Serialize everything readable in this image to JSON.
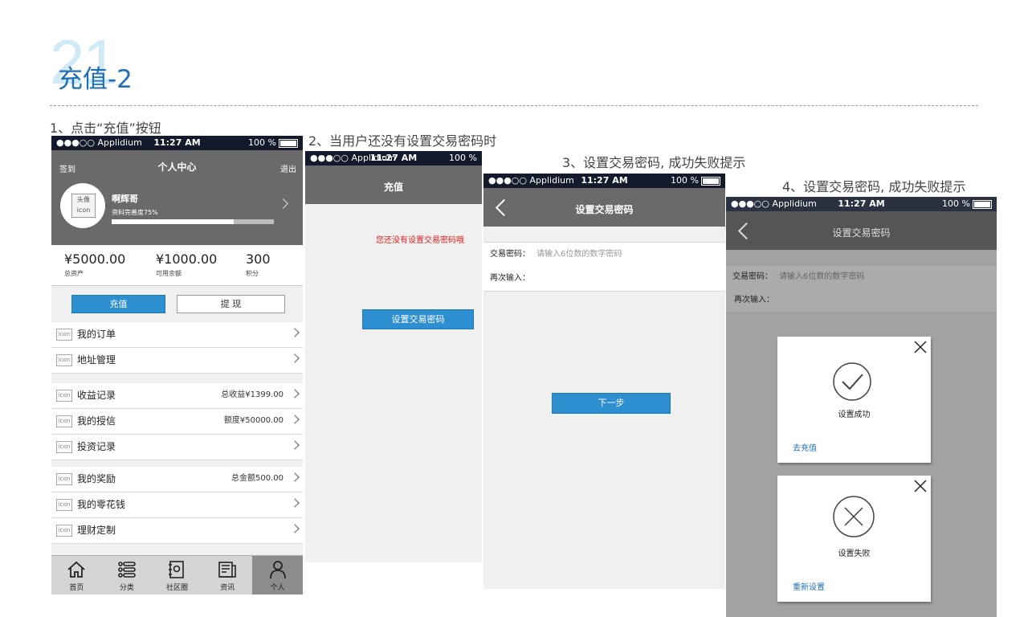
{
  "page": {
    "number": "21",
    "title": "充值-2"
  },
  "steps": [
    "1、点击“充值”按钮",
    "2、当用户还没有设置交易密码时",
    "3、设置交易密码, 成功失败提示",
    "4、设置交易密码, 成功失败提示"
  ],
  "statusbar": {
    "carrier": "●●●○○ Applidium ",
    "time": "11:27 AM",
    "battery": "100 %"
  },
  "screen1": {
    "header": {
      "left": "签到",
      "title": "个人中心",
      "right": "退出"
    },
    "profile": {
      "avatar": "头像 icon",
      "name": "啊辉哥",
      "completion": "资料完善度75%",
      "progress": 0.75
    },
    "stats": [
      {
        "value": "¥5000.00",
        "label": "总资产"
      },
      {
        "value": "¥1000.00",
        "label": "可用余额"
      },
      {
        "value": "300",
        "label": "积分"
      }
    ],
    "recharge_button": "充值",
    "withdraw_button": "提 现",
    "icon_text": "icon",
    "group1": [
      {
        "label": "我的订单",
        "value": ""
      },
      {
        "label": "地址管理",
        "value": ""
      }
    ],
    "group2": [
      {
        "label": "收益记录",
        "value": "总收益¥1399.00"
      },
      {
        "label": "我的授信",
        "value": "额度¥50000.00"
      },
      {
        "label": "投资记录",
        "value": ""
      }
    ],
    "group3": [
      {
        "label": "我的奖励",
        "value": "总金额500.00"
      },
      {
        "label": "我的零花钱",
        "value": ""
      },
      {
        "label": "理财定制",
        "value": ""
      }
    ],
    "tabs": [
      {
        "label": "首页",
        "icon": "home-icon"
      },
      {
        "label": "分类",
        "icon": "list-icon"
      },
      {
        "label": "社区圈",
        "icon": "community-icon"
      },
      {
        "label": "资讯",
        "icon": "news-icon"
      },
      {
        "label": "个人",
        "icon": "user-icon"
      }
    ]
  },
  "screen2": {
    "title": "充值",
    "warning": "您还没有设置交易密码哦",
    "button": "设置交易密码"
  },
  "screen3": {
    "title": "设置交易密码",
    "password_label": "交易密码：",
    "password_placeholder": "请输入6位数的数字密码",
    "confirm_label": "再次输入：",
    "button": "下一步"
  },
  "screen4": {
    "title": "设置交易密码",
    "password_label": "交易密码：",
    "password_placeholder": "请输入6位数的数字密码",
    "confirm_label": "再次输入：",
    "success": {
      "text": "设置成功",
      "link": "去充值"
    },
    "fail": {
      "text": "设置失败",
      "link": "重新设置"
    }
  },
  "colors": {
    "accent": "#2d8ed0",
    "header_gray": "#6a6a6a",
    "warning": "#e02020",
    "title_blue": "#1f6fb5"
  }
}
